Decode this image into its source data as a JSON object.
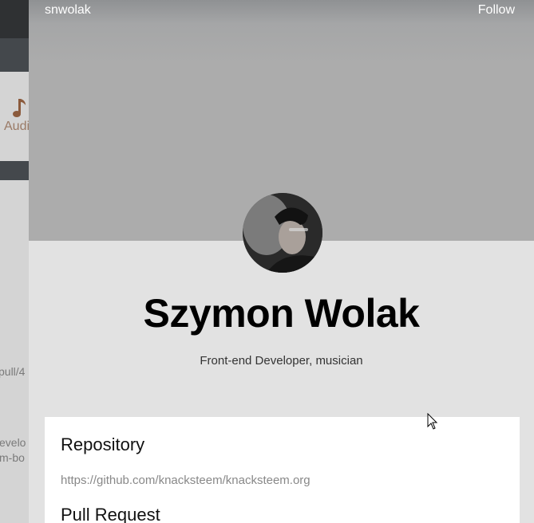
{
  "background_page": {
    "audio_label": "Audi",
    "text_pull": "pull/4",
    "text_dev_line1": "evelo",
    "text_dev_line2": "m-bo"
  },
  "profile": {
    "username": "snwolak",
    "follow_label": "Follow",
    "name": "Szymon Wolak",
    "bio": "Front-end Developer, musician"
  },
  "card": {
    "repository_heading": "Repository",
    "repository_url": "https://github.com/knacksteem/knacksteem.org",
    "pull_request_heading": "Pull Request"
  },
  "colors": {
    "cover": "#acacac",
    "page_bg": "#e2e2e2",
    "card_bg": "#ffffff",
    "topbar": "#2f3133"
  },
  "icons": [
    "music-note-icon",
    "avatar",
    "mouse-cursor-icon"
  ]
}
